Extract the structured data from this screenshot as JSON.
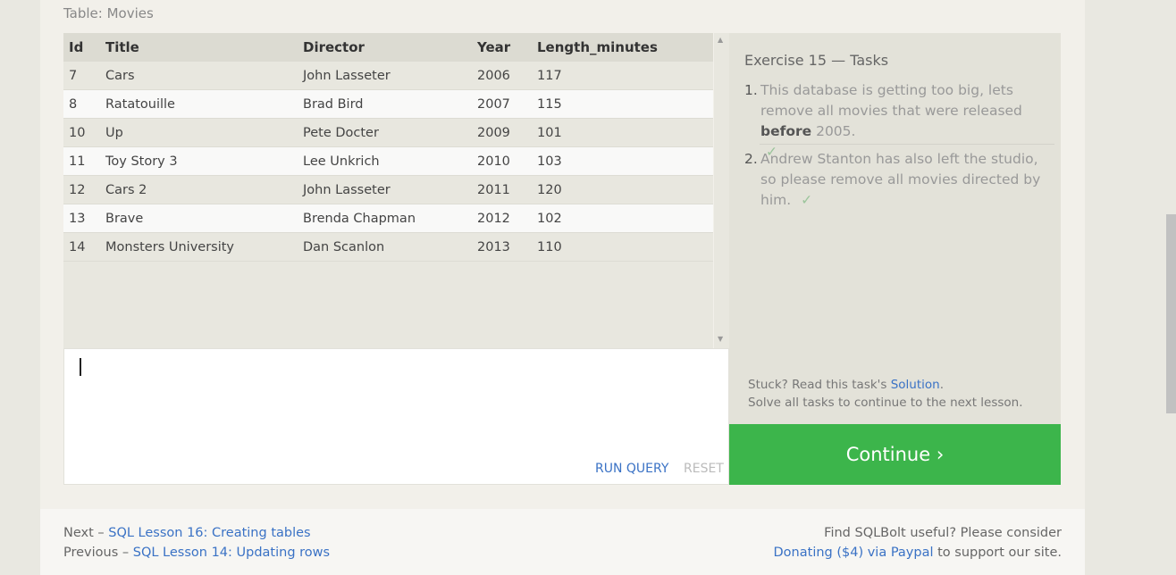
{
  "table_caption": "Table: Movies",
  "table": {
    "columns": [
      "Id",
      "Title",
      "Director",
      "Year",
      "Length_minutes"
    ],
    "rows": [
      [
        "7",
        "Cars",
        "John Lasseter",
        "2006",
        "117"
      ],
      [
        "8",
        "Ratatouille",
        "Brad Bird",
        "2007",
        "115"
      ],
      [
        "10",
        "Up",
        "Pete Docter",
        "2009",
        "101"
      ],
      [
        "11",
        "Toy Story 3",
        "Lee Unkrich",
        "2010",
        "103"
      ],
      [
        "12",
        "Cars 2",
        "John Lasseter",
        "2011",
        "120"
      ],
      [
        "13",
        "Brave",
        "Brenda Chapman",
        "2012",
        "102"
      ],
      [
        "14",
        "Monsters University",
        "Dan Scanlon",
        "2013",
        "110"
      ]
    ]
  },
  "editor": {
    "value": "",
    "run_label": "RUN QUERY",
    "reset_label": "RESET"
  },
  "tasks": {
    "title": "Exercise 15 — Tasks",
    "items": [
      {
        "num": "1.",
        "text_before": "This database is getting too big, lets remove all movies that were released ",
        "text_bold": "before",
        "text_after": " 2005.",
        "check": "✓"
      },
      {
        "num": "2.",
        "text": "Andrew Stanton has also left the studio, so please remove all movies directed by him.",
        "check": "✓"
      }
    ],
    "stuck_prefix": "Stuck? Read this task's ",
    "solution_link": "Solution",
    "stuck_suffix": ".",
    "solve_all": "Solve all tasks to continue to the next lesson.",
    "continue_label": "Continue ›"
  },
  "footer": {
    "next_prefix": "Next – ",
    "next_link": "SQL Lesson 16: Creating tables",
    "prev_prefix": "Previous – ",
    "prev_link": "SQL Lesson 14: Updating rows",
    "right_line1": "Find SQLBolt useful? Please consider",
    "donate_link": "Donating ($4) via Paypal",
    "right_suffix": " to support our site."
  },
  "colors": {
    "accent_link": "#3a72c5",
    "continue_bg": "#3cb54b",
    "check": "#9cc59c"
  },
  "icons": {
    "scroll_up": "triangle-up-icon",
    "scroll_down": "triangle-down-icon"
  }
}
